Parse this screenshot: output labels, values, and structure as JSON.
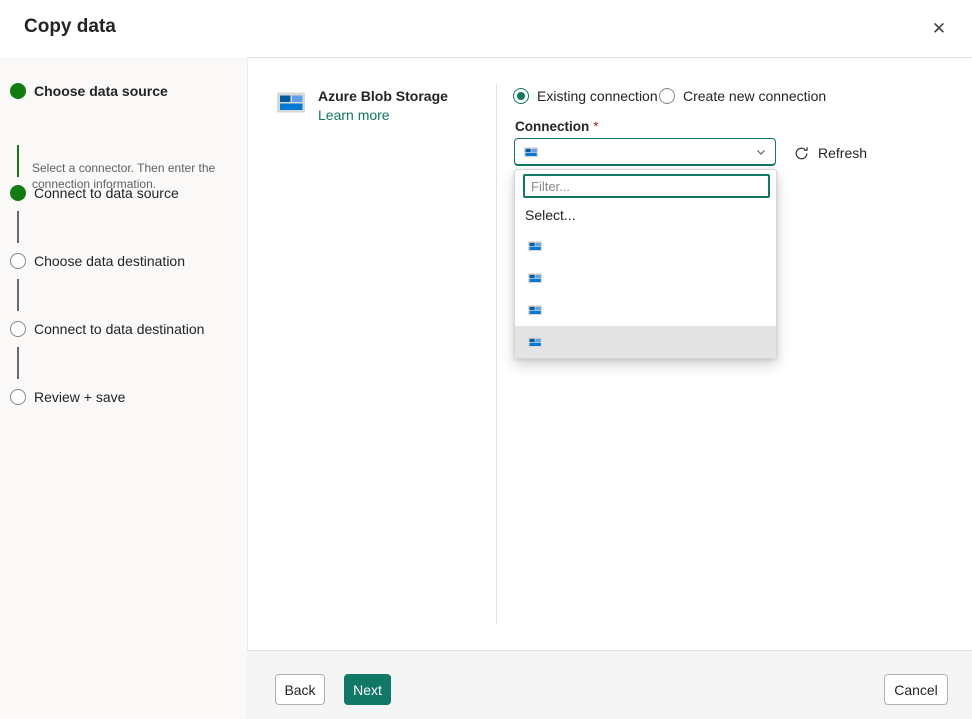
{
  "header": {
    "title": "Copy data",
    "close_glyph": "✕"
  },
  "sidebar": {
    "steps": [
      {
        "label": "Choose data source",
        "description": "Select a connector. Then enter the connection information.",
        "state": "done"
      },
      {
        "label": "Connect to data source",
        "state": "done"
      },
      {
        "label": "Choose data destination",
        "state": "todo"
      },
      {
        "label": "Connect to data destination",
        "state": "todo"
      },
      {
        "label": "Review + save",
        "state": "todo"
      }
    ]
  },
  "connector": {
    "name": "Azure Blob Storage",
    "learn_more_label": "Learn more",
    "icon": "azure-blob-storage-icon"
  },
  "connection": {
    "existing_label": "Existing connection",
    "create_new_label": "Create new connection",
    "field_label": "Connection",
    "required_marker": "*",
    "refresh_label": "Refresh",
    "filter_placeholder": "Filter...",
    "select_option_label": "Select...",
    "selected_value_icon": "azure-blob-storage-icon",
    "options": [
      {
        "icon": "azure-blob-storage-icon",
        "label": ""
      },
      {
        "icon": "azure-blob-storage-icon",
        "label": ""
      },
      {
        "icon": "azure-blob-storage-icon",
        "label": ""
      },
      {
        "icon": "azure-blob-storage-icon",
        "label": "",
        "highlighted": true
      }
    ]
  },
  "footer": {
    "back_label": "Back",
    "next_label": "Next",
    "cancel_label": "Cancel"
  },
  "colors": {
    "accent": "#117865",
    "step_complete": "#107c10",
    "required": "#a4262c",
    "option_highlight": "#e4e4e4"
  }
}
